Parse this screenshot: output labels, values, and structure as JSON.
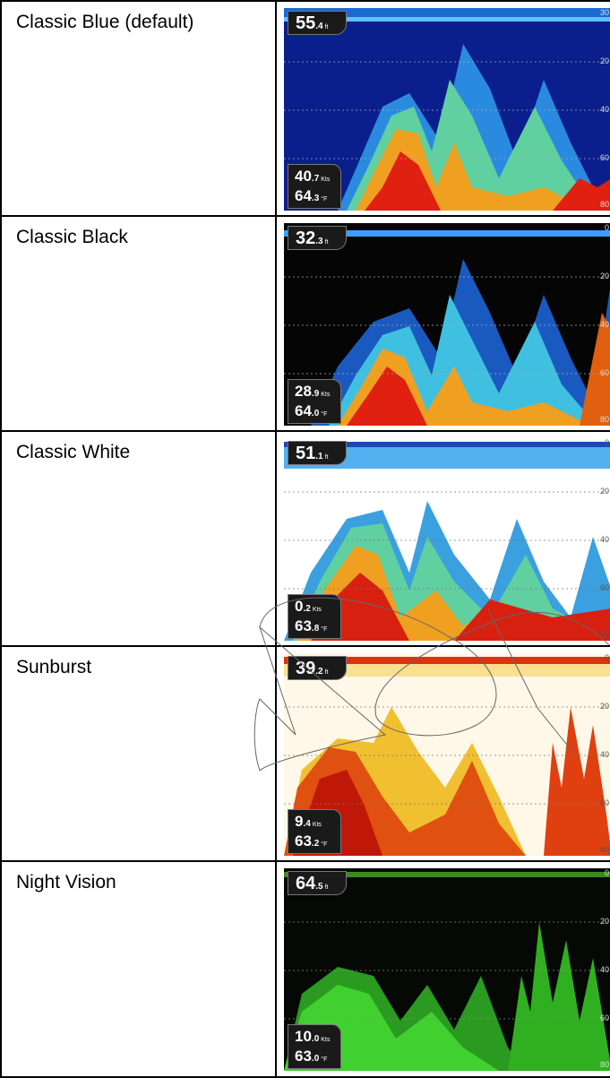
{
  "rows": [
    {
      "label": "Classic Blue (default)",
      "depth": "55",
      "depth_dec": ".4",
      "depth_unit": "ft",
      "speed": "40",
      "speed_dec": ".7",
      "speed_unit": "Kts",
      "temp": "64",
      "temp_dec": ".3",
      "temp_unit": "°F",
      "scale": [
        "20",
        "40",
        "60",
        "80"
      ],
      "scale_top": "30"
    },
    {
      "label": "Classic Black",
      "depth": "32",
      "depth_dec": ".3",
      "depth_unit": "ft",
      "speed": "28",
      "speed_dec": ".9",
      "speed_unit": "Kts",
      "temp": "64",
      "temp_dec": ".0",
      "temp_unit": "°F",
      "scale": [
        "20",
        "40",
        "60",
        "80"
      ],
      "scale_top": "0"
    },
    {
      "label": "Classic White",
      "depth": "51",
      "depth_dec": ".1",
      "depth_unit": "ft",
      "speed": "0",
      "speed_dec": ".2",
      "speed_unit": "Kts",
      "temp": "63",
      "temp_dec": ".8",
      "temp_unit": "°F",
      "scale": [
        "20",
        "40",
        "60",
        "80"
      ],
      "scale_top": "0"
    },
    {
      "label": "Sunburst",
      "depth": "39",
      "depth_dec": ".2",
      "depth_unit": "ft",
      "speed": "9",
      "speed_dec": ".4",
      "speed_unit": "Kts",
      "temp": "63",
      "temp_dec": ".2",
      "temp_unit": "°F",
      "scale": [
        "20",
        "40",
        "60",
        "80"
      ],
      "scale_top": "0"
    },
    {
      "label": "Night Vision",
      "depth": "64",
      "depth_dec": ".5",
      "depth_unit": "ft",
      "speed": "10",
      "speed_dec": ".0",
      "speed_unit": "Kts",
      "temp": "63",
      "temp_dec": ".0",
      "temp_unit": "°F",
      "scale": [
        "20",
        "40",
        "60",
        "80"
      ],
      "scale_top": "0"
    }
  ],
  "palette_colors": {
    "classic_blue": {
      "bg": "#0a1f8c",
      "mid": "#3aa0e0",
      "hot": "#e02010"
    },
    "classic_black": {
      "bg": "#050505",
      "mid": "#2aa0e0",
      "hot": "#e02010"
    },
    "classic_white": {
      "bg": "#ffffff",
      "mid": "#3ab0e0",
      "hot": "#d82010"
    },
    "sunburst": {
      "bg": "#fff8e8",
      "mid": "#f0b020",
      "hot": "#c01808"
    },
    "night_vision": {
      "bg": "#050805",
      "mid": "#2a9a20",
      "hot": "#40ff30"
    }
  }
}
